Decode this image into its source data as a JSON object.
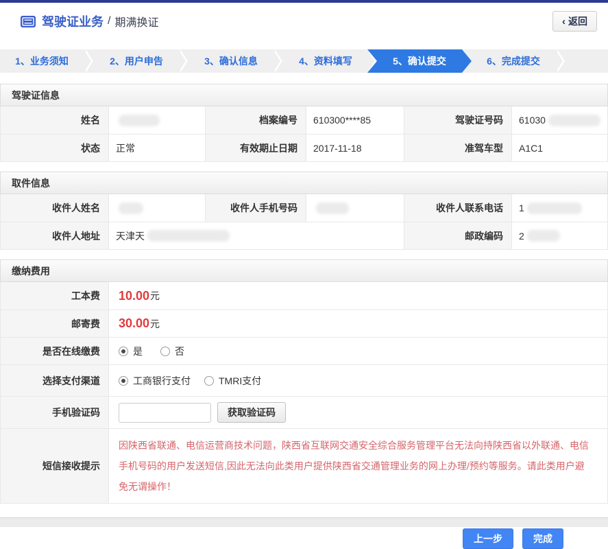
{
  "header": {
    "title": "驾驶证业务",
    "separator": "/",
    "subtitle": "期满换证",
    "back_chevron": "‹",
    "back_label": "返回"
  },
  "steps": [
    {
      "label": "1、业务须知",
      "active": false
    },
    {
      "label": "2、用户申告",
      "active": false
    },
    {
      "label": "3、确认信息",
      "active": false
    },
    {
      "label": "4、资料填写",
      "active": false
    },
    {
      "label": "5、确认提交",
      "active": true
    },
    {
      "label": "6、完成提交",
      "active": false
    }
  ],
  "license_info": {
    "section_title": "驾驶证信息",
    "fields": [
      {
        "label": "姓名",
        "value": "",
        "redacted": true
      },
      {
        "label": "档案编号",
        "value": "610300****85",
        "redacted": false
      },
      {
        "label": "驾驶证号码",
        "value": "61030",
        "redacted": true
      },
      {
        "label": "状态",
        "value": "正常",
        "redacted": false
      },
      {
        "label": "有效期止日期",
        "value": "2017-11-18",
        "redacted": false
      },
      {
        "label": "准驾车型",
        "value": "A1C1",
        "redacted": false
      }
    ]
  },
  "pickup_info": {
    "section_title": "取件信息",
    "fields": [
      {
        "label": "收件人姓名",
        "value": "",
        "redacted": true
      },
      {
        "label": "收件人手机号码",
        "value": "",
        "redacted": true
      },
      {
        "label": "收件人联系电话",
        "value": "1",
        "redacted": true
      },
      {
        "label": "收件人地址",
        "value": "天津天",
        "redacted": true
      },
      {
        "label": "邮政编码",
        "value": "2",
        "redacted": true
      }
    ]
  },
  "payment": {
    "section_title": "缴纳费用",
    "fee_card": {
      "label": "工本费",
      "amount": "10.00",
      "unit": "元"
    },
    "fee_post": {
      "label": "邮寄费",
      "amount": "30.00",
      "unit": "元"
    },
    "online_pay": {
      "label": "是否在线缴费",
      "options": [
        {
          "label": "是",
          "selected": true
        },
        {
          "label": "否",
          "selected": false
        }
      ]
    },
    "channel": {
      "label": "选择支付渠道",
      "options": [
        {
          "label": "工商银行支付",
          "selected": true
        },
        {
          "label": "TMRI支付",
          "selected": false
        }
      ]
    },
    "captcha": {
      "label": "手机验证码",
      "input_value": "",
      "button_label": "获取验证码"
    },
    "sms_tip": {
      "label": "短信接收提示",
      "text": "因陕西省联通、电信运营商技术问题，陕西省互联网交通安全综合服务管理平台无法向持陕西省以外联通、电信手机号码的用户发送短信,因此无法向此类用户提供陕西省交通管理业务的网上办理/预约等服务。请此类用户避免无谓操作！"
    }
  },
  "actions": {
    "prev_label": "上一步",
    "finish_label": "完成"
  },
  "colors": {
    "topbar_navy": "#2b3a94",
    "title_blue": "#3a5fc8",
    "step_text_blue": "#2e6dd9",
    "active_step_blue": "#2e7ae2",
    "fee_red": "#e4393c",
    "tip_red": "#d5656a",
    "primary_button_blue": "#4285f4"
  }
}
